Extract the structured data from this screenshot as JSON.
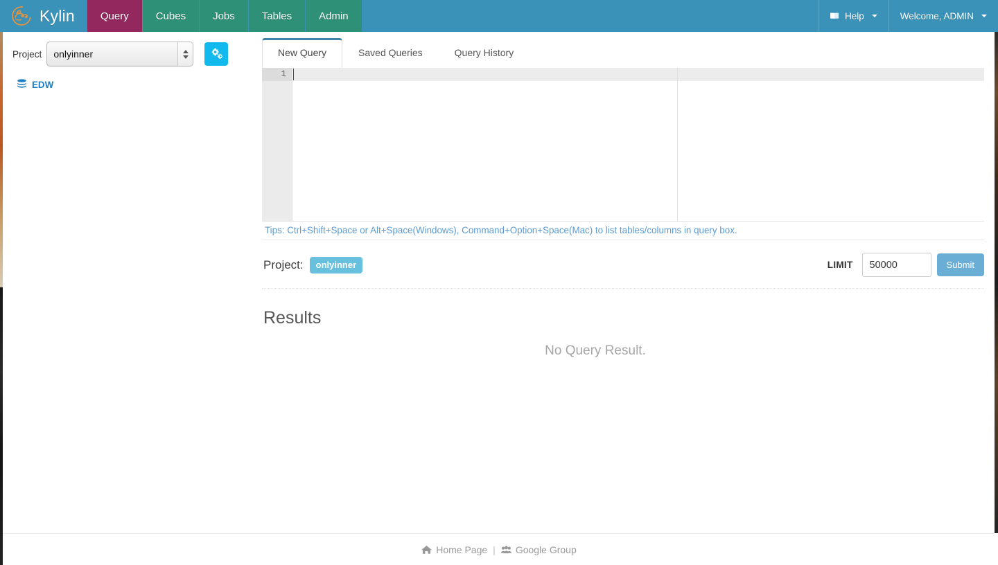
{
  "navbar": {
    "brand": "Kylin",
    "brand_logo_icon": "kylin-logo-icon",
    "items": [
      {
        "label": "Query",
        "active": true
      },
      {
        "label": "Cubes",
        "active": false
      },
      {
        "label": "Jobs",
        "active": false
      },
      {
        "label": "Tables",
        "active": false
      },
      {
        "label": "Admin",
        "active": false
      }
    ],
    "help": {
      "label": "Help",
      "icon": "book-icon"
    },
    "user": {
      "label": "Welcome, ADMIN",
      "icon": "caret-down-icon"
    }
  },
  "sidebar": {
    "project_label": "Project",
    "project_value": "onlyinner",
    "project_options": [
      "onlyinner"
    ],
    "settings_button_icon": "cogs-icon",
    "tree": [
      {
        "label": "EDW",
        "icon": "database-icon"
      }
    ]
  },
  "main": {
    "tabs": [
      {
        "label": "New Query",
        "active": true
      },
      {
        "label": "Saved Queries",
        "active": false
      },
      {
        "label": "Query History",
        "active": false
      }
    ],
    "editor": {
      "line_numbers": [
        "1"
      ],
      "value": "",
      "placeholder": ""
    },
    "tips": "Tips: Ctrl+Shift+Space or Alt+Space(Windows), Command+Option+Space(Mac) to list tables/columns in query box.",
    "submit_bar": {
      "project_label": "Project:",
      "project_tag": "onlyinner",
      "limit_label": "LIMIT",
      "limit_value": "50000",
      "submit_label": "Submit"
    },
    "results": {
      "title": "Results",
      "empty_text": "No Query Result."
    }
  },
  "footer": {
    "home_label": "Home Page",
    "home_icon": "home-icon",
    "separator": "|",
    "group_label": "Google Group",
    "group_icon": "users-icon"
  },
  "colors": {
    "navbar_bg": "#3b92b8",
    "nav_item_bg": "#2e9177",
    "nav_active_bg": "#93285f",
    "accent_cyan": "#12b9ed",
    "tag_blue": "#67c0de",
    "submit_blue": "#6aaed6",
    "link_blue": "#5b9bd1",
    "tree_blue": "#1f7fc4",
    "tab_active_border": "#4282a8"
  }
}
